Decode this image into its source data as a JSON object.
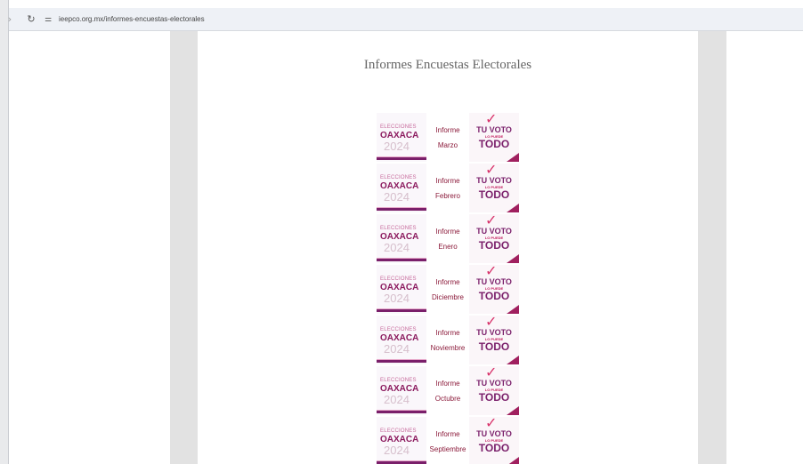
{
  "browser": {
    "url": "ieepco.org.mx/informes-encuestas-electorales"
  },
  "page": {
    "title": "Informes Encuestas Electorales"
  },
  "logos": {
    "left": {
      "line1": "ELECCIONES",
      "line2": "OAXACA",
      "line3": "2024"
    },
    "right": {
      "line1": "TU VOTO",
      "line2": "LO PUEDE",
      "line3": "TODO"
    }
  },
  "reports": [
    {
      "line1": "Informe",
      "line2": "Marzo"
    },
    {
      "line1": "Informe",
      "line2": "Febrero"
    },
    {
      "line1": "Informe",
      "line2": "Enero"
    },
    {
      "line1": "Informe",
      "line2": "Diciembre"
    },
    {
      "line1": "Informe",
      "line2": "Noviembre"
    },
    {
      "line1": "Informe",
      "line2": "Octubre"
    },
    {
      "line1": "Informe",
      "line2": "Septiembre"
    }
  ],
  "colors": {
    "accent": "#8b1a5e",
    "label": "#8b1a3a",
    "gutter": "#e2e2e2"
  }
}
